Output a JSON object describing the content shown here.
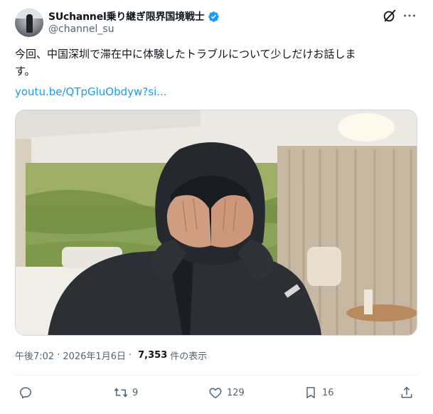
{
  "author": {
    "display_name": "SUchannel乗り継ぎ限界国境戦士",
    "handle": "@channel_su"
  },
  "tweet": {
    "text": "今回、中国深圳で滞在中に体験したトラブルについて少しだけお話しま\nす。",
    "link": "youtu.be/QTpGluObdyw?si...",
    "time": "午後7:02",
    "date": "2026年1月6日",
    "views_count": "7,353",
    "views_label": "件の表示"
  },
  "actions": {
    "retweets": "9",
    "likes": "129",
    "bookmarks": "16"
  },
  "icons": [
    "verified-badge-icon",
    "grok-icon",
    "more-icon",
    "reply-icon",
    "retweet-icon",
    "like-icon",
    "bookmark-icon",
    "share-icon"
  ],
  "colors": {
    "link": "#1d9bf0",
    "secondary_text": "#536471",
    "verified": "#1d9bf0"
  }
}
